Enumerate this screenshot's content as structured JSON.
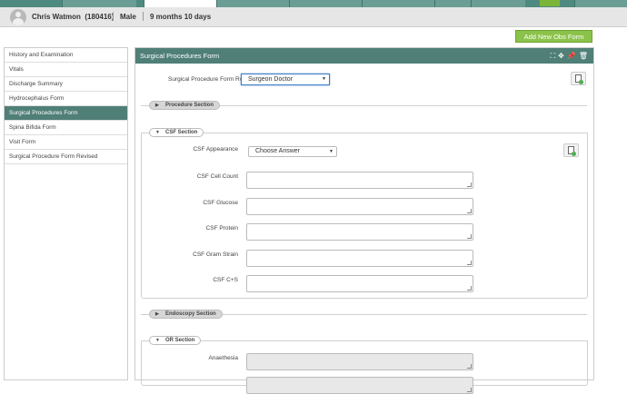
{
  "patient": {
    "name": "Chris Watmon",
    "id": "(180416)",
    "gender": "Male",
    "age": "9 months 10 days"
  },
  "add_obs_button": "Add New Obs Form",
  "sidebar": {
    "items": [
      {
        "label": "History and Examination"
      },
      {
        "label": "Vitals"
      },
      {
        "label": "Discharge Summary"
      },
      {
        "label": "Hydrocephalus Form"
      },
      {
        "label": "Surgical Procedures Form"
      },
      {
        "label": "Spina Bifida Form"
      },
      {
        "label": "Visit Form"
      },
      {
        "label": "Surgical Procedure Form Revised"
      }
    ],
    "active_index": 4
  },
  "form": {
    "title": "Surgical Procedures Form",
    "role_label": "Surgical Procedure Form Role",
    "role_value": "Surgeon Doctor",
    "sections": {
      "procedure": "Procedure Section",
      "csf": "CSF Section",
      "endoscopy": "Endoscopy Section",
      "or": "OR Section"
    },
    "csf_fields": {
      "appearance": "CSF Appearance",
      "appearance_value": "Choose Answer",
      "cell_count": "CSF Cell Count",
      "glucose": "CSF Glucose",
      "protein": "CSF Protein",
      "gram_strain": "CSF Gram Strain",
      "cs": "CSF C+S"
    },
    "or_fields": {
      "anaethesia": "Anaethesia"
    }
  },
  "icons": {
    "header": [
      "expand-icon",
      "move-icon",
      "pin-icon",
      "trash-icon"
    ],
    "notes": "add-note-icon",
    "avatar": "user-avatar-icon"
  },
  "colors": {
    "accent": "#4f7f76",
    "add_button": "#8bc34a"
  }
}
